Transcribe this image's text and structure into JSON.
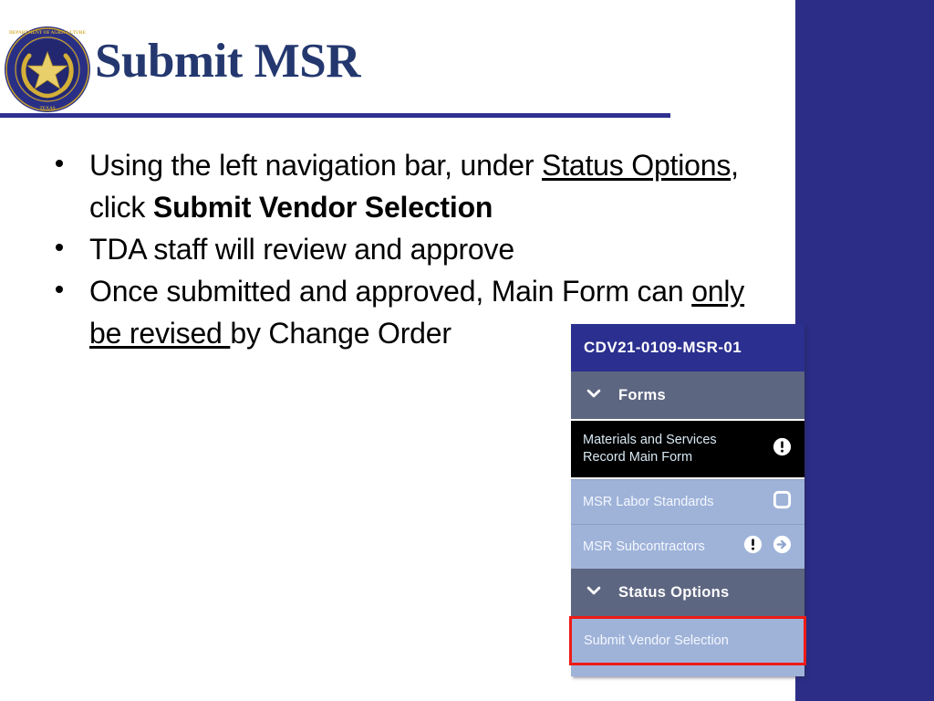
{
  "slide": {
    "title": "Submit MSR",
    "logo_icon": "texas-department-of-agriculture-seal",
    "seal_ring_text": "DEPARTMENT OF AGRICULTURE",
    "seal_bottom_text": "TEXAS",
    "accent_color": "#2e3191",
    "title_color": "#24386f",
    "band_color": "#2b2d87",
    "bullets": [
      {
        "id": "bullet-1",
        "segments": [
          {
            "text": "Using the left navigation bar, under ",
            "style": "normal"
          },
          {
            "text": "Status Options",
            "style": "underline"
          },
          {
            "text": ", click ",
            "style": "normal"
          },
          {
            "text": "Submit Vendor Selection",
            "style": "bold"
          }
        ]
      },
      {
        "id": "bullet-2",
        "segments": [
          {
            "text": "TDA staff will review and approve",
            "style": "normal"
          }
        ]
      },
      {
        "id": "bullet-3",
        "segments": [
          {
            "text": "Once submitted and approved, Main Form can ",
            "style": "normal"
          },
          {
            "text": "only be revised ",
            "style": "underline"
          },
          {
            "text": "by Change Order",
            "style": "normal"
          }
        ]
      }
    ]
  },
  "nav_panel": {
    "record_id": "CDV21-0109-MSR-01",
    "title_bar_color": "#2b2f8f",
    "group_header_color": "#5d6681",
    "item_color": "#9fb3d9",
    "highlight_color": "#ee1b16",
    "groups": [
      {
        "id": "forms",
        "label": "Forms",
        "chevron_icon": "chevron-down-icon",
        "items": [
          {
            "id": "materials-and-services-record-main-form",
            "label_line_1": "Materials and Services",
            "label_line_2": "Record Main Form",
            "state": "selected",
            "icons": [
              "exclamation-circle-icon"
            ]
          },
          {
            "id": "msr-labor-standards",
            "label_line_1": "MSR Labor Standards",
            "label_line_2": "",
            "state": "default",
            "icons": [
              "checkbox-square-icon"
            ]
          },
          {
            "id": "msr-subcontractors",
            "label_line_1": "MSR Subcontractors",
            "label_line_2": "",
            "state": "default",
            "icons": [
              "exclamation-circle-icon",
              "arrow-right-circle-icon"
            ]
          }
        ]
      },
      {
        "id": "status-options",
        "label": "Status Options",
        "chevron_icon": "chevron-down-icon",
        "items": [
          {
            "id": "submit-vendor-selection",
            "label_line_1": "Submit Vendor Selection",
            "label_line_2": "",
            "state": "highlighted",
            "icons": []
          }
        ]
      }
    ]
  }
}
